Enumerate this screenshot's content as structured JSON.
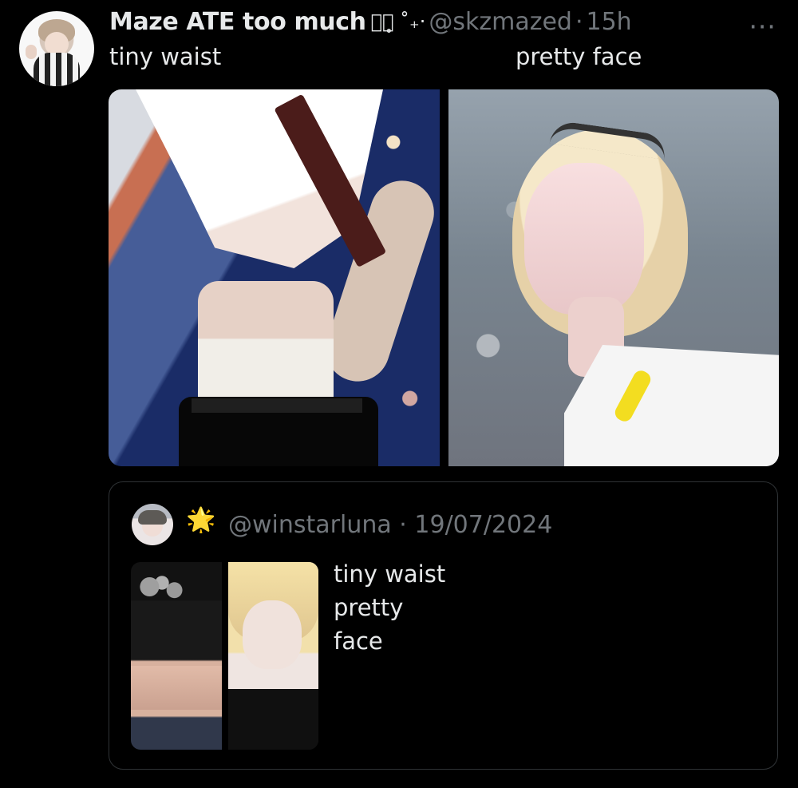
{
  "tweet": {
    "display_name": "Maze ATE too much",
    "display_deco": "ᨳ᪶̥ ˚₊·",
    "handle": "@skzmazed",
    "separator": "·",
    "time": "15h",
    "more_icon": "⋯",
    "text": "tiny waist                                        pretty face"
  },
  "media": {
    "left_photo": "photo-left",
    "right_photo": "photo-right"
  },
  "quote": {
    "emoji": "🌟",
    "handle": "@winstarluna",
    "separator": "·",
    "date": "19/07/2024",
    "text": "tiny waist                                        pretty\nface"
  },
  "colors": {
    "background": "#000000",
    "primary_text": "#e7e9ea",
    "secondary_text": "#71767b",
    "border": "#2f3336"
  },
  "icons": {
    "more": "more-icon",
    "quote_badge": "star-icon"
  }
}
